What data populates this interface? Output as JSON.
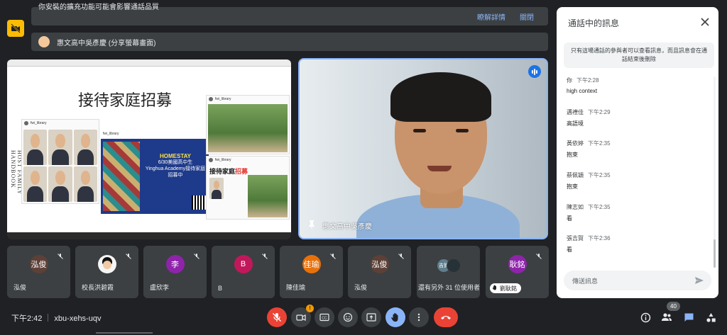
{
  "banners": {
    "extension_warning": "你安裝的擴充功能可能會影響通話品質",
    "details_link": "瞭解詳情",
    "dismiss_link": "關閉",
    "presenter_label": "惠文高中吳彥慶 (分享螢幕畫面)"
  },
  "slide": {
    "title": "接待家庭招募",
    "vertical_text": "HOST FAMILY HANDBOOK",
    "post_account": "fwi_library",
    "poster_heading": "HOMESTAY",
    "poster_line1": "6/30美國高中生",
    "poster_line2": "Yinghua Academy接待家庭招募中",
    "sticker": "接待家庭",
    "sticker_accent": "招募"
  },
  "speaker": {
    "name": "惠文高中吳彥慶"
  },
  "participants": [
    {
      "initial": "泓俊",
      "name": "泓俊",
      "color": "#5d4037"
    },
    {
      "initial": "",
      "name": "校長洪碧霞",
      "color": "#ffffff"
    },
    {
      "initial": "李",
      "name": "盧欣李",
      "color": "#8e24aa"
    },
    {
      "initial": "B",
      "name": "B",
      "color": "#c2185b"
    },
    {
      "initial": "佳瑜",
      "name": "陳佳瑜",
      "color": "#e8710a"
    },
    {
      "initial": "泓俊",
      "name": "泓俊",
      "color": "#5d4037"
    }
  ],
  "others_tile": {
    "label": "還有另外 31 位使用者",
    "avatar_text": "吉賀"
  },
  "pinned_tile": {
    "initial": "耿銘",
    "color": "#8e24aa",
    "name": "劉耿銘"
  },
  "bottom_bar": {
    "time": "下午2:42",
    "meeting_code": "xbu-xehs-uqv",
    "participant_count": "40",
    "notification_count": "!"
  },
  "chat": {
    "title": "通話中的訊息",
    "notice": "只有這場通話的參與者可以查看訊息，而且訊息會在通話結束後刪除",
    "messages": [
      {
        "sender": "你",
        "time": "下午2:28",
        "text": "high context"
      },
      {
        "sender": "邁禮佳",
        "time": "下午2:29",
        "text": "高語境"
      },
      {
        "sender": "黃依婷",
        "time": "下午2:35",
        "text": "抱束"
      },
      {
        "sender": "蔡佩穎",
        "time": "下午2:35",
        "text": "抱束"
      },
      {
        "sender": "陳志如",
        "time": "下午2:35",
        "text": "看"
      },
      {
        "sender": "張吉賀",
        "time": "下午2:36",
        "text": "看"
      }
    ],
    "input_placeholder": "傳送訊息"
  },
  "colors": {
    "background": "#202124",
    "tile": "#3c4043",
    "accent_blue": "#8ab4f8",
    "danger_red": "#ea4335",
    "warning_yellow": "#fbbc04"
  }
}
